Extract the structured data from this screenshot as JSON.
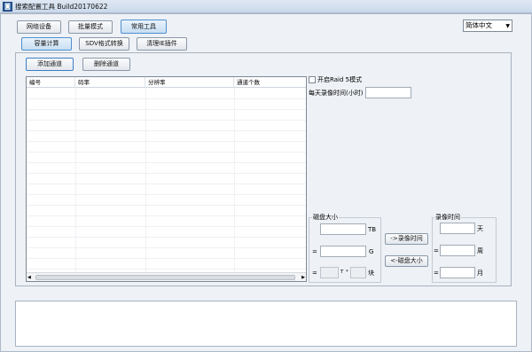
{
  "titlebar": {
    "title": "搜索配置工具 Build20170622",
    "icon": "app-icon"
  },
  "tabs": [
    {
      "label": "网络设备"
    },
    {
      "label": "批量模式"
    },
    {
      "label": "常用工具"
    }
  ],
  "language": {
    "selected": "简体中文"
  },
  "subtabs": [
    {
      "label": "容量计算"
    },
    {
      "label": "SDV格式转换"
    },
    {
      "label": "清理IE插件"
    }
  ],
  "toolbar": {
    "add_channel": "添加通道",
    "delete_channel": "删除通道"
  },
  "table": {
    "columns": [
      "编号",
      "码率",
      "分辨率",
      "通道个数"
    ],
    "rows": []
  },
  "settings": {
    "raid_label": "开启Raid 5模式",
    "raid_checked": false,
    "daily_record_label": "每天录像时间(小时)",
    "daily_record_value": ""
  },
  "disk_group": {
    "title": "磁盘大小",
    "unit_tb": "TB",
    "unit_g": "G",
    "unit_t": "T",
    "unit_block": "块",
    "eq1": "=",
    "eq2": "=",
    "star": "*"
  },
  "buttons": {
    "to_record_time": "->录像时间",
    "to_disk_size": "<-磁盘大小"
  },
  "record_group": {
    "title": "录像时间",
    "unit_day": "天",
    "unit_week": "周",
    "unit_month": "月",
    "eq1": "=",
    "eq2": "="
  },
  "colors": {
    "accent": "#4f8fd0",
    "window_bg": "#eef1f5"
  }
}
